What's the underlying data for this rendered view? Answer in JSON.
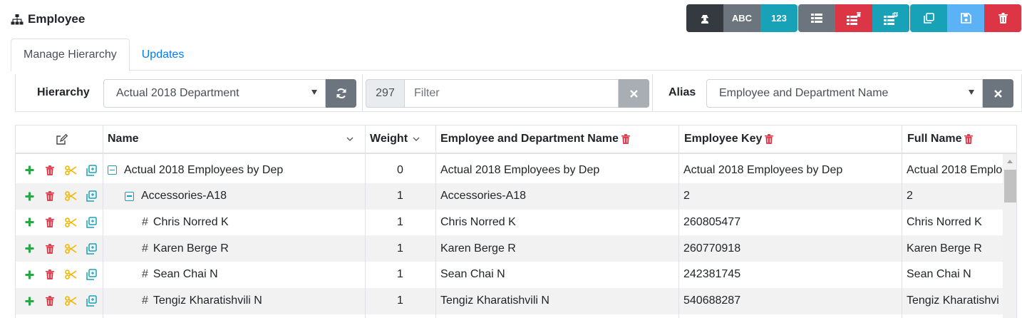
{
  "page": {
    "title": "Employee",
    "title_icon": "sitemap-icon"
  },
  "toolbar": {
    "abc_label": "ABC",
    "num_label": "123",
    "colors": {
      "dark": "#343a40",
      "gray": "#6c757d",
      "teal": "#17a2b8",
      "red": "#dc3545",
      "blue": "#5bb2f5"
    }
  },
  "tabs": [
    {
      "label": "Manage Hierarchy",
      "active": true
    },
    {
      "label": "Updates",
      "active": false
    }
  ],
  "filters": {
    "hierarchy_label": "Hierarchy",
    "hierarchy_value": "Actual 2018 Department",
    "count": "297",
    "filter_placeholder": "Filter",
    "alias_label": "Alias",
    "alias_value": "Employee and Department Name"
  },
  "grid": {
    "columns": [
      {
        "label": "Name"
      },
      {
        "label": "Weight"
      },
      {
        "label": "Employee and Department Name"
      },
      {
        "label": "Employee Key"
      },
      {
        "label": "Full Name"
      }
    ],
    "rows": [
      {
        "type": "group",
        "depth": 0,
        "name": "Actual 2018 Employees by Dep",
        "weight": "0",
        "alias": "Actual 2018 Employees by Dep",
        "key": "Actual 2018 Employees by Dep",
        "full": "Actual 2018 Emplo"
      },
      {
        "type": "group",
        "depth": 1,
        "name": "Accessories-A18",
        "weight": "1",
        "alias": "Accessories-A18",
        "key": "2",
        "full": "2"
      },
      {
        "type": "leaf",
        "depth": 2,
        "name": "Chris Norred K",
        "weight": "1",
        "alias": "Chris Norred K",
        "key": "260805477",
        "full": "Chris Norred K"
      },
      {
        "type": "leaf",
        "depth": 2,
        "name": "Karen Berge R",
        "weight": "1",
        "alias": "Karen Berge R",
        "key": "260770918",
        "full": "Karen Berge R"
      },
      {
        "type": "leaf",
        "depth": 2,
        "name": "Sean Chai N",
        "weight": "1",
        "alias": "Sean Chai N",
        "key": "242381745",
        "full": "Sean Chai N"
      },
      {
        "type": "leaf",
        "depth": 2,
        "name": "Tengiz Kharatishvili N",
        "weight": "1",
        "alias": "Tengiz Kharatishvili N",
        "key": "540688287",
        "full": "Tengiz Kharatishvi"
      }
    ]
  }
}
